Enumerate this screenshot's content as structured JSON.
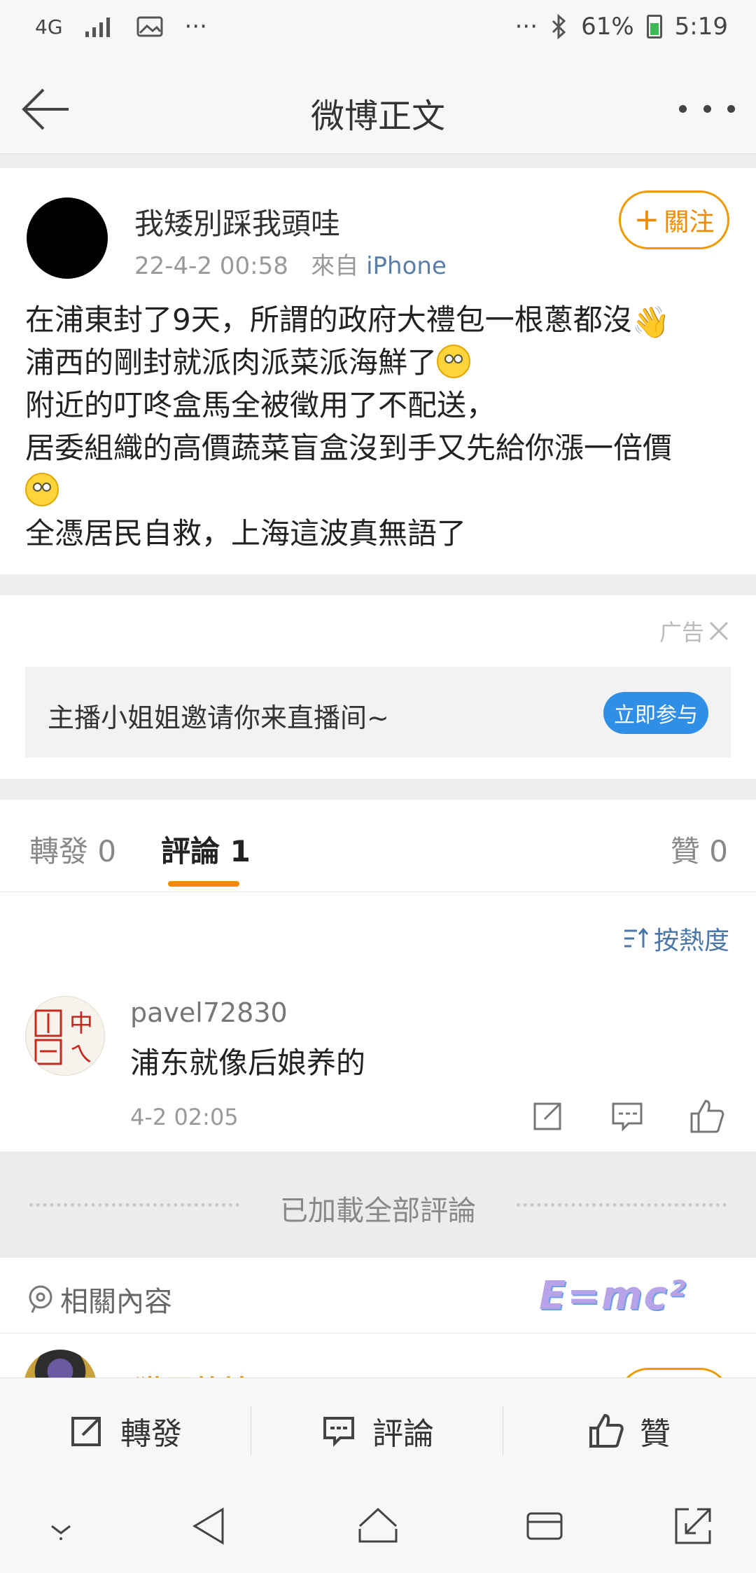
{
  "status_bar": {
    "network": "4G",
    "more_left": "···",
    "more_right": "···",
    "battery": "61%",
    "time": "5:19"
  },
  "nav": {
    "title": "微博正文"
  },
  "post": {
    "username": "我矮別踩我頭哇",
    "timestamp": "22-4-2 00:58",
    "source_prefix": "來自",
    "source": "iPhone",
    "follow_label": "關注",
    "lines": [
      "在浦東封了9天，所謂的政府大禮包一根蔥都沒",
      "浦西的剛封就派肉派菜派海鮮了",
      "附近的叮咚盒馬全被徵用了不配送，",
      "居委組織的高價蔬菜盲盒沒到手又先給你漲一倍價",
      "",
      "全憑居民自救，上海這波真無語了"
    ]
  },
  "ad": {
    "label": "广告",
    "text": "主播小姐姐邀请你来直播间~",
    "button": "立即参与"
  },
  "tabs": {
    "repost": "轉發 0",
    "comments": "評論 1",
    "likes": "贊 0"
  },
  "sort_label": "按熱度",
  "comment": {
    "username": "pavel72830",
    "text": "浦东就像后娘养的",
    "time": "4-2 02:05"
  },
  "loaded_text": "已加載全部評論",
  "related_label": "相關內容",
  "related_sticker": "E=mc²",
  "peek_name": "猫屋乾坤",
  "actions": {
    "repost": "轉發",
    "comment": "評論",
    "like": "贊"
  },
  "colors": {
    "accent_orange": "#f28a00",
    "link_blue": "#4a77a8",
    "ad_button_blue": "#2f8fe6"
  }
}
